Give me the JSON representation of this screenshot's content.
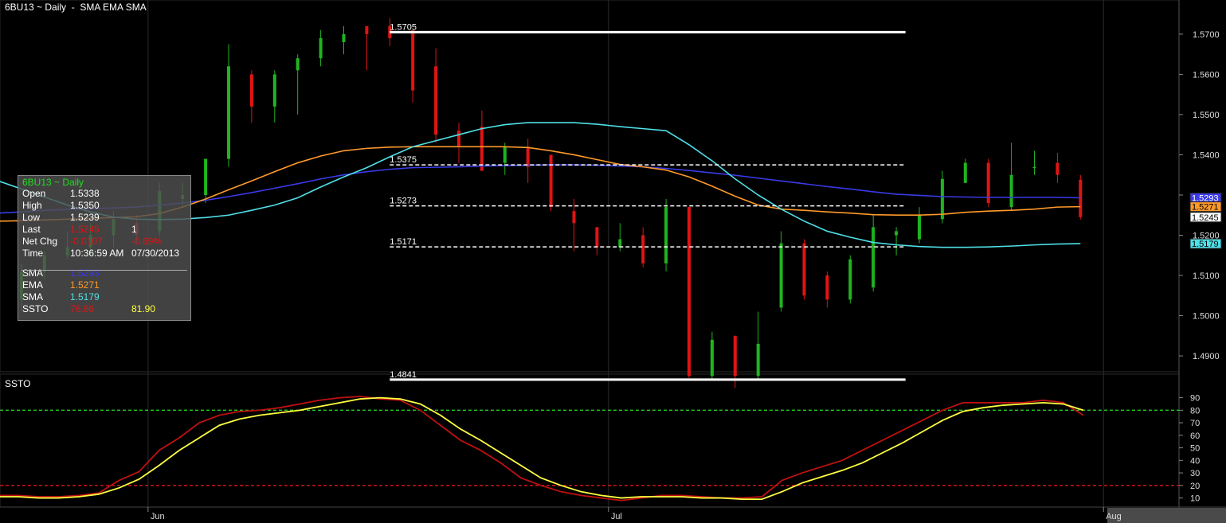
{
  "chart_title": "6BU13 ~ Daily  -  SMA EMA SMA",
  "indicator_title": "SSTO",
  "colors": {
    "up": "#1fb51f",
    "down": "#e01414",
    "sma_fast": "#3a3ae6",
    "ema": "#ff9a2a",
    "sma_slow": "#4fe0e8",
    "ssto_k": "#c01010",
    "ssto_d": "#ffff40",
    "level_hi": "#22cc22",
    "level_lo": "#e01414",
    "fib": "#ffffff",
    "info_green": "#22dd22",
    "info_red": "#e01414",
    "info_yellow": "#ffff40"
  },
  "info_box": {
    "header": "6BU13 ~ Daily",
    "rows": [
      {
        "label": "Open",
        "value": "1.5338",
        "value2": "",
        "color": "#ffffff",
        "color2": "#ffffff"
      },
      {
        "label": "High",
        "value": "1.5350",
        "value2": "",
        "color": "#ffffff",
        "color2": "#ffffff"
      },
      {
        "label": "Low",
        "value": "1.5239",
        "value2": "",
        "color": "#ffffff",
        "color2": "#ffffff"
      },
      {
        "label": "Last",
        "value": "1.5245",
        "value2": "1",
        "color": "#e01414",
        "color2": "#ffffff"
      },
      {
        "label": "Net Chg",
        "value": "-0.0107",
        "value2": "-0.69%",
        "color": "#e01414",
        "color2": "#e01414"
      },
      {
        "label": "Time",
        "value": "10:36:59 AM",
        "value2": "07/30/2013",
        "color": "#ffffff",
        "color2": "#ffffff"
      },
      {
        "label": "SMA",
        "value": "1.5293",
        "value2": "",
        "color": "#3a3ae6",
        "color2": "#ffffff"
      },
      {
        "label": "EMA",
        "value": "1.5271",
        "value2": "",
        "color": "#ff9a2a",
        "color2": "#ffffff"
      },
      {
        "label": "SMA",
        "value": "1.5179",
        "value2": "",
        "color": "#4fe0e8",
        "color2": "#ffffff"
      },
      {
        "label": "SSTO",
        "value": "76.66",
        "value2": "81.90",
        "color": "#e01414",
        "color2": "#ffff40"
      }
    ]
  },
  "chart_data": [
    {
      "type": "candlestick",
      "title": "6BU13 ~ Daily  -  SMA EMA SMA",
      "x_labels": [
        "Jun",
        "Jul",
        "Aug"
      ],
      "x_label_at_bar": [
        6.5,
        26.5,
        48
      ],
      "ylim": [
        1.4815,
        1.5775
      ],
      "y_ticks": [
        1.49,
        1.5,
        1.51,
        1.52,
        1.53,
        1.54,
        1.55,
        1.56,
        1.57
      ],
      "y_tick_labels": [
        "1.4900",
        "1.5000",
        "1.5100",
        "1.5200",
        "",
        "1.5400",
        "1.5500",
        "1.5600",
        "1.5700"
      ],
      "candles": [
        {
          "o": 1.521,
          "h": 1.522,
          "l": 1.5055,
          "c": 1.506
        },
        {
          "o": 1.504,
          "h": 1.513,
          "l": 1.501,
          "c": 1.511
        },
        {
          "o": 1.511,
          "h": 1.516,
          "l": 1.509,
          "c": 1.515
        },
        {
          "o": 1.515,
          "h": 1.521,
          "l": 1.514,
          "c": 1.517
        },
        {
          "o": 1.517,
          "h": 1.523,
          "l": 1.515,
          "c": 1.52
        },
        {
          "o": 1.52,
          "h": 1.526,
          "l": 1.517,
          "c": 1.524
        },
        {
          "o": 1.523,
          "h": 1.525,
          "l": 1.518,
          "c": 1.52
        },
        {
          "o": 1.521,
          "h": 1.533,
          "l": 1.52,
          "c": 1.531
        },
        {
          "o": 1.529,
          "h": 1.533,
          "l": 1.527,
          "c": 1.53
        },
        {
          "o": 1.53,
          "h": 1.539,
          "l": 1.528,
          "c": 1.539
        },
        {
          "o": 1.539,
          "h": 1.5675,
          "l": 1.537,
          "c": 1.562
        },
        {
          "o": 1.56,
          "h": 1.561,
          "l": 1.548,
          "c": 1.552
        },
        {
          "o": 1.552,
          "h": 1.561,
          "l": 1.548,
          "c": 1.56
        },
        {
          "o": 1.561,
          "h": 1.565,
          "l": 1.55,
          "c": 1.564
        },
        {
          "o": 1.564,
          "h": 1.571,
          "l": 1.562,
          "c": 1.569
        },
        {
          "o": 1.568,
          "h": 1.572,
          "l": 1.565,
          "c": 1.57
        },
        {
          "o": 1.572,
          "h": 1.572,
          "l": 1.561,
          "c": 1.57
        },
        {
          "o": 1.572,
          "h": 1.574,
          "l": 1.567,
          "c": 1.569
        },
        {
          "o": 1.571,
          "h": 1.571,
          "l": 1.553,
          "c": 1.556
        },
        {
          "o": 1.562,
          "h": 1.5665,
          "l": 1.543,
          "c": 1.545
        },
        {
          "o": 1.546,
          "h": 1.548,
          "l": 1.538,
          "c": 1.542
        },
        {
          "o": 1.547,
          "h": 1.551,
          "l": 1.536,
          "c": 1.536
        },
        {
          "o": 1.538,
          "h": 1.543,
          "l": 1.535,
          "c": 1.542
        },
        {
          "o": 1.542,
          "h": 1.544,
          "l": 1.533,
          "c": 1.537
        },
        {
          "o": 1.54,
          "h": 1.54,
          "l": 1.526,
          "c": 1.527
        },
        {
          "o": 1.526,
          "h": 1.529,
          "l": 1.516,
          "c": 1.523
        },
        {
          "o": 1.522,
          "h": 1.522,
          "l": 1.515,
          "c": 1.517
        },
        {
          "o": 1.517,
          "h": 1.523,
          "l": 1.516,
          "c": 1.519
        },
        {
          "o": 1.52,
          "h": 1.522,
          "l": 1.512,
          "c": 1.513
        },
        {
          "o": 1.513,
          "h": 1.529,
          "l": 1.511,
          "c": 1.527
        },
        {
          "o": 1.527,
          "h": 1.527,
          "l": 1.4845,
          "c": 1.485
        },
        {
          "o": 1.485,
          "h": 1.496,
          "l": 1.484,
          "c": 1.494
        },
        {
          "o": 1.495,
          "h": 1.495,
          "l": 1.482,
          "c": 1.485
        },
        {
          "o": 1.485,
          "h": 1.501,
          "l": 1.484,
          "c": 1.493
        },
        {
          "o": 1.502,
          "h": 1.521,
          "l": 1.501,
          "c": 1.518
        },
        {
          "o": 1.518,
          "h": 1.519,
          "l": 1.504,
          "c": 1.505
        },
        {
          "o": 1.51,
          "h": 1.511,
          "l": 1.502,
          "c": 1.504
        },
        {
          "o": 1.504,
          "h": 1.515,
          "l": 1.503,
          "c": 1.514
        },
        {
          "o": 1.507,
          "h": 1.525,
          "l": 1.506,
          "c": 1.522
        },
        {
          "o": 1.52,
          "h": 1.522,
          "l": 1.515,
          "c": 1.521
        },
        {
          "o": 1.519,
          "h": 1.527,
          "l": 1.518,
          "c": 1.525
        },
        {
          "o": 1.524,
          "h": 1.536,
          "l": 1.523,
          "c": 1.534
        },
        {
          "o": 1.533,
          "h": 1.539,
          "l": 1.533,
          "c": 1.538
        },
        {
          "o": 1.538,
          "h": 1.539,
          "l": 1.527,
          "c": 1.528
        },
        {
          "o": 1.527,
          "h": 1.543,
          "l": 1.526,
          "c": 1.535
        },
        {
          "o": 1.537,
          "h": 1.541,
          "l": 1.535,
          "c": 1.537
        },
        {
          "o": 1.538,
          "h": 1.5405,
          "l": 1.533,
          "c": 1.535
        },
        {
          "o": 1.5338,
          "h": 1.535,
          "l": 1.5239,
          "c": 1.5245
        }
      ],
      "series": [
        {
          "name": "SMA",
          "color": "#3a3ae6",
          "values": [
            1.5255,
            1.5258,
            1.5262,
            1.5264,
            1.5266,
            1.5268,
            1.527,
            1.5275,
            1.528,
            1.5287,
            1.5296,
            1.5306,
            1.5317,
            1.5328,
            1.534,
            1.535,
            1.5358,
            1.5364,
            1.5368,
            1.5369,
            1.537,
            1.5372,
            1.5373,
            1.5374,
            1.5375,
            1.5375,
            1.5374,
            1.5372,
            1.537,
            1.5366,
            1.5361,
            1.5355,
            1.5349,
            1.5342,
            1.5335,
            1.5328,
            1.5321,
            1.5315,
            1.5308,
            1.5302,
            1.5299,
            1.5296,
            1.5295,
            1.5294,
            1.5294,
            1.5294,
            1.5294,
            1.5293
          ]
        },
        {
          "name": "EMA",
          "color": "#ff9a2a",
          "values": [
            1.5235,
            1.5236,
            1.5238,
            1.524,
            1.5242,
            1.5244,
            1.5246,
            1.5254,
            1.527,
            1.529,
            1.5313,
            1.5335,
            1.5358,
            1.538,
            1.5397,
            1.541,
            1.5416,
            1.5419,
            1.542,
            1.542,
            1.542,
            1.542,
            1.542,
            1.5418,
            1.541,
            1.54,
            1.5388,
            1.5376,
            1.537,
            1.5362,
            1.5345,
            1.5322,
            1.5297,
            1.5275,
            1.5265,
            1.5262,
            1.5258,
            1.5255,
            1.5251,
            1.525,
            1.525,
            1.5252,
            1.5257,
            1.526,
            1.5262,
            1.5265,
            1.527,
            1.5271
          ]
        },
        {
          "name": "SMA",
          "color": "#4fe0e8",
          "values": [
            1.5335,
            1.5315,
            1.5295,
            1.5275,
            1.5258,
            1.5245,
            1.524,
            1.5239,
            1.524,
            1.5244,
            1.525,
            1.5262,
            1.5275,
            1.5293,
            1.532,
            1.5345,
            1.5368,
            1.5395,
            1.542,
            1.5435,
            1.545,
            1.5465,
            1.5475,
            1.548,
            1.548,
            1.548,
            1.5476,
            1.547,
            1.5465,
            1.546,
            1.5425,
            1.5385,
            1.534,
            1.53,
            1.5265,
            1.5235,
            1.521,
            1.5195,
            1.5182,
            1.5176,
            1.5172,
            1.517,
            1.517,
            1.5171,
            1.5173,
            1.5176,
            1.5178,
            1.5179
          ]
        }
      ],
      "horizontal_levels": [
        {
          "label": "1.5705",
          "value": 1.5705,
          "style": "solid"
        },
        {
          "label": "1.5375",
          "value": 1.5375,
          "style": "dashed"
        },
        {
          "label": "1.5273",
          "value": 1.5273,
          "style": "dashed"
        },
        {
          "label": "1.5171",
          "value": 1.5171,
          "style": "dashed"
        },
        {
          "label": "1.4841",
          "value": 1.4841,
          "style": "solid"
        }
      ],
      "level_start_bar": 17,
      "level_end_bar": 39.4,
      "last_value_tags": [
        {
          "label": "1.5293",
          "value": 1.5293,
          "color": "#3a3ae6",
          "text_color": "#ffffff"
        },
        {
          "label": "1.5271",
          "value": 1.5271,
          "color": "#ff9a2a",
          "text_color": "#000000"
        },
        {
          "label": "1.5245",
          "value": 1.5245,
          "color": "#ffffff",
          "text_color": "#000000"
        },
        {
          "label": "1.5179",
          "value": 1.5179,
          "color": "#4fe0e8",
          "text_color": "#000000"
        }
      ]
    },
    {
      "type": "line",
      "title": "SSTO",
      "ylim": [
        4,
        98
      ],
      "y_ticks": [
        10,
        20,
        30,
        40,
        50,
        60,
        70,
        80,
        90
      ],
      "y_tick_labels": [
        "10",
        "20",
        "30",
        "40",
        "50",
        "60",
        "70",
        "80",
        "90"
      ],
      "levels": [
        {
          "value": 80,
          "color": "#22cc22"
        },
        {
          "value": 20,
          "color": "#e01414"
        }
      ],
      "series": [
        {
          "name": "%K",
          "color": "#c01010",
          "values": [
            12,
            12,
            11,
            11,
            12,
            14,
            24,
            31,
            48,
            58,
            70,
            76,
            79,
            80,
            82,
            85,
            88,
            90,
            91,
            89,
            88,
            80,
            68,
            56,
            48,
            38,
            26,
            20,
            15,
            12,
            10,
            8,
            10,
            12,
            12,
            11,
            10,
            10,
            11,
            24,
            30,
            35,
            40,
            48,
            56,
            64,
            72,
            80,
            86,
            86,
            86,
            86,
            88,
            86,
            76
          ]
        },
        {
          "name": "%D",
          "color": "#ffff40",
          "values": [
            11,
            11,
            10,
            10,
            11,
            13,
            18,
            25,
            36,
            48,
            58,
            68,
            73,
            76,
            78,
            80,
            83,
            86,
            89,
            90,
            89,
            85,
            76,
            65,
            56,
            46,
            36,
            26,
            20,
            15,
            12,
            10,
            11,
            11,
            11,
            10,
            10,
            9,
            9,
            15,
            22,
            27,
            32,
            38,
            46,
            54,
            63,
            72,
            79,
            82,
            84,
            85,
            86,
            85,
            80
          ]
        }
      ]
    }
  ]
}
